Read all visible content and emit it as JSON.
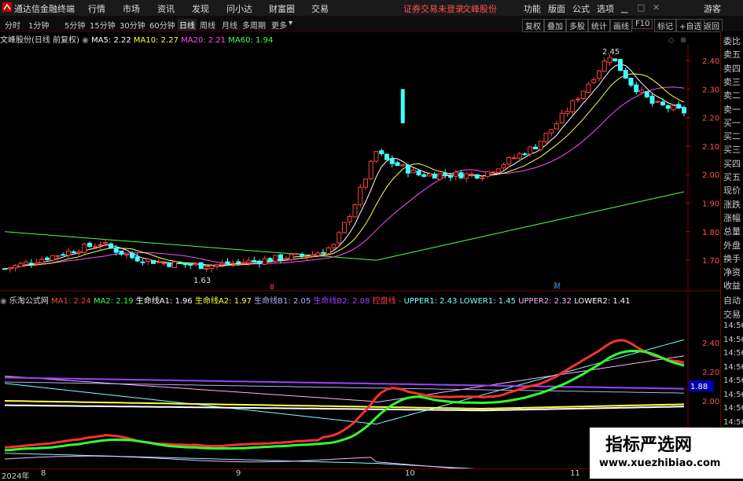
{
  "app": {
    "title": "通达信金融终端",
    "menu": [
      "行情",
      "市场",
      "资讯",
      "发现",
      "问小达",
      "财富圈",
      "交易"
    ],
    "notice": "证券交易未登录",
    "stock_name_top": "文峰股份",
    "right_menu": [
      "功能",
      "版面",
      "公式",
      "选项"
    ],
    "user": "游客"
  },
  "tabs": {
    "periods": [
      "分时",
      "1分钟",
      "5分钟",
      "15分钟",
      "30分钟",
      "60分钟",
      "日线",
      "周线",
      "月线",
      "多周期",
      "更多"
    ],
    "active": "日线",
    "right_buttons": [
      "复权",
      "叠加",
      "多股",
      "统计",
      "画线",
      "F10",
      "标记",
      "+自选",
      "返回"
    ]
  },
  "price_chart": {
    "title": "文峰股份(日线 前复权)",
    "ma": [
      {
        "label": "MA5: 2.22",
        "color": "#ffffff"
      },
      {
        "label": "MA10: 2.27",
        "color": "#ffff4d"
      },
      {
        "label": "MA20: 2.21",
        "color": "#ff4dff"
      },
      {
        "label": "MA60: 1.94",
        "color": "#4dff4d"
      }
    ],
    "y_ticks": [
      "2.40",
      "2.30",
      "2.20",
      "2.10",
      "2.00",
      "1.90",
      "1.80",
      "1.70"
    ],
    "high_label": "2.45",
    "low_label": "1.63",
    "markers": [
      "8",
      "财"
    ]
  },
  "indicator_chart": {
    "title": "乐淘公式网",
    "items": [
      {
        "label": "MA1: 2.24",
        "color": "#ff4040"
      },
      {
        "label": "MA2: 2.19",
        "color": "#40ff40"
      },
      {
        "label": "生命线A1: 1.96",
        "color": "#ffffff"
      },
      {
        "label": "生命线A2: 1.97",
        "color": "#ffff40"
      },
      {
        "label": "生命线B1: 2.05",
        "color": "#b0b0ff"
      },
      {
        "label": "生命线B2: 2.08",
        "color": "#a040ff"
      },
      {
        "label": "控盘线 -",
        "color": "#ff4040"
      },
      {
        "label": "UPPER1: 2.43",
        "color": "#80ffff"
      },
      {
        "label": "LOWER1: 1.45",
        "color": "#80ffff"
      },
      {
        "label": "UPPER2: 2.32",
        "color": "#ffb0ff"
      },
      {
        "label": "LOWER2: 1.41",
        "color": "#ffffff"
      }
    ],
    "y_ticks": [
      "2.40",
      "2.20",
      "2.00",
      "1.80"
    ],
    "current_value": "1.88"
  },
  "right_panel": {
    "items": [
      "委比",
      "卖五",
      "卖四",
      "卖三",
      "卖二",
      "卖一",
      "买一",
      "买二",
      "买三",
      "买四",
      "买五",
      "现价",
      "涨跌",
      "涨幅",
      "总量",
      "外盘",
      "换手",
      "净资",
      "收益"
    ],
    "lower": [
      "自动",
      "交易",
      "14:56",
      "14:56",
      "14:56",
      "14:56",
      "14:56",
      "14:56",
      "14:56",
      "14:56",
      "14:56"
    ]
  },
  "x_axis": [
    "2024年",
    "8",
    "9",
    "10",
    "11"
  ],
  "watermark": {
    "title": "指标严选网",
    "url": "www.xuezhibiao.com"
  }
}
